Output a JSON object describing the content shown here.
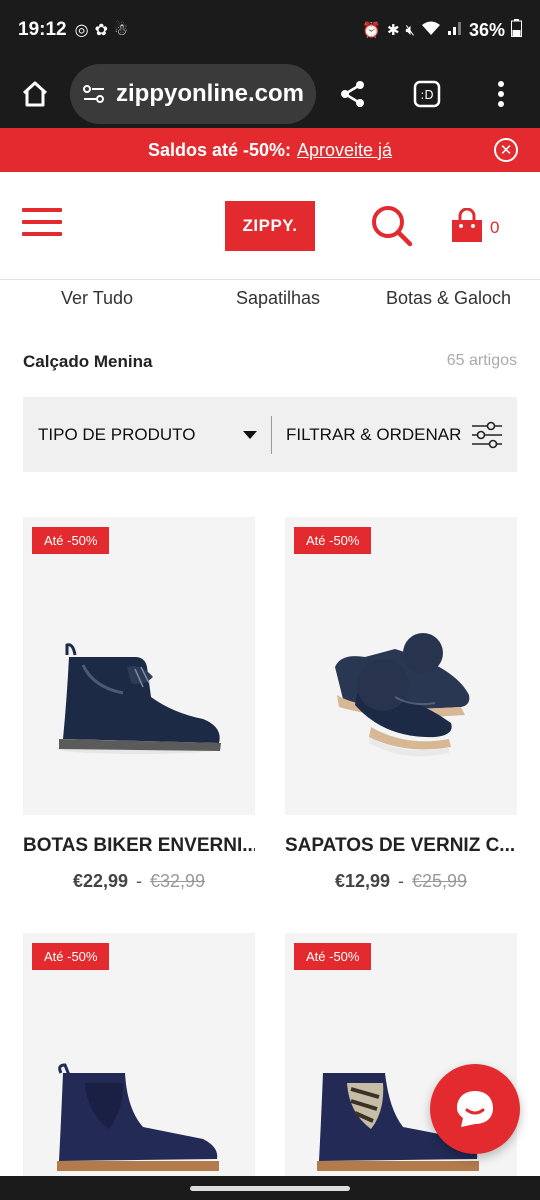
{
  "status_bar": {
    "time": "19:12",
    "battery": "36%"
  },
  "browser": {
    "url": "zippyonline.com"
  },
  "promo": {
    "bold_text": "Saldos até -50%:",
    "link_text": "Aproveite já"
  },
  "header": {
    "logo_text": "ZIPPY.",
    "cart_count": "0"
  },
  "categories": [
    {
      "label": "Ver Tudo"
    },
    {
      "label": "Sapatilhas"
    },
    {
      "label": "Botas & Galoch"
    }
  ],
  "listing": {
    "title": "Calçado Menina",
    "count": "65 artigos"
  },
  "filters": {
    "product_type_label": "TIPO DE PRODUTO",
    "filter_sort_label": "FILTRAR & ORDENAR"
  },
  "products": [
    {
      "badge": "Até -50%",
      "name": "BOTAS BIKER ENVERNI...",
      "price": "€22,99",
      "dash": "-",
      "old_price": "€32,99"
    },
    {
      "badge": "Até -50%",
      "name": "SAPATOS DE VERNIZ C...",
      "price": "€12,99",
      "dash": "-",
      "old_price": "€25,99"
    },
    {
      "badge": "Até -50%",
      "name": "",
      "price": "",
      "dash": "",
      "old_price": ""
    },
    {
      "badge": "Até -50%",
      "name": "",
      "price": "",
      "dash": "",
      "old_price": ""
    }
  ],
  "colors": {
    "brand_red": "#e32b2f",
    "dark_bar": "#1b1b1b",
    "navy": "#1c2a45"
  }
}
